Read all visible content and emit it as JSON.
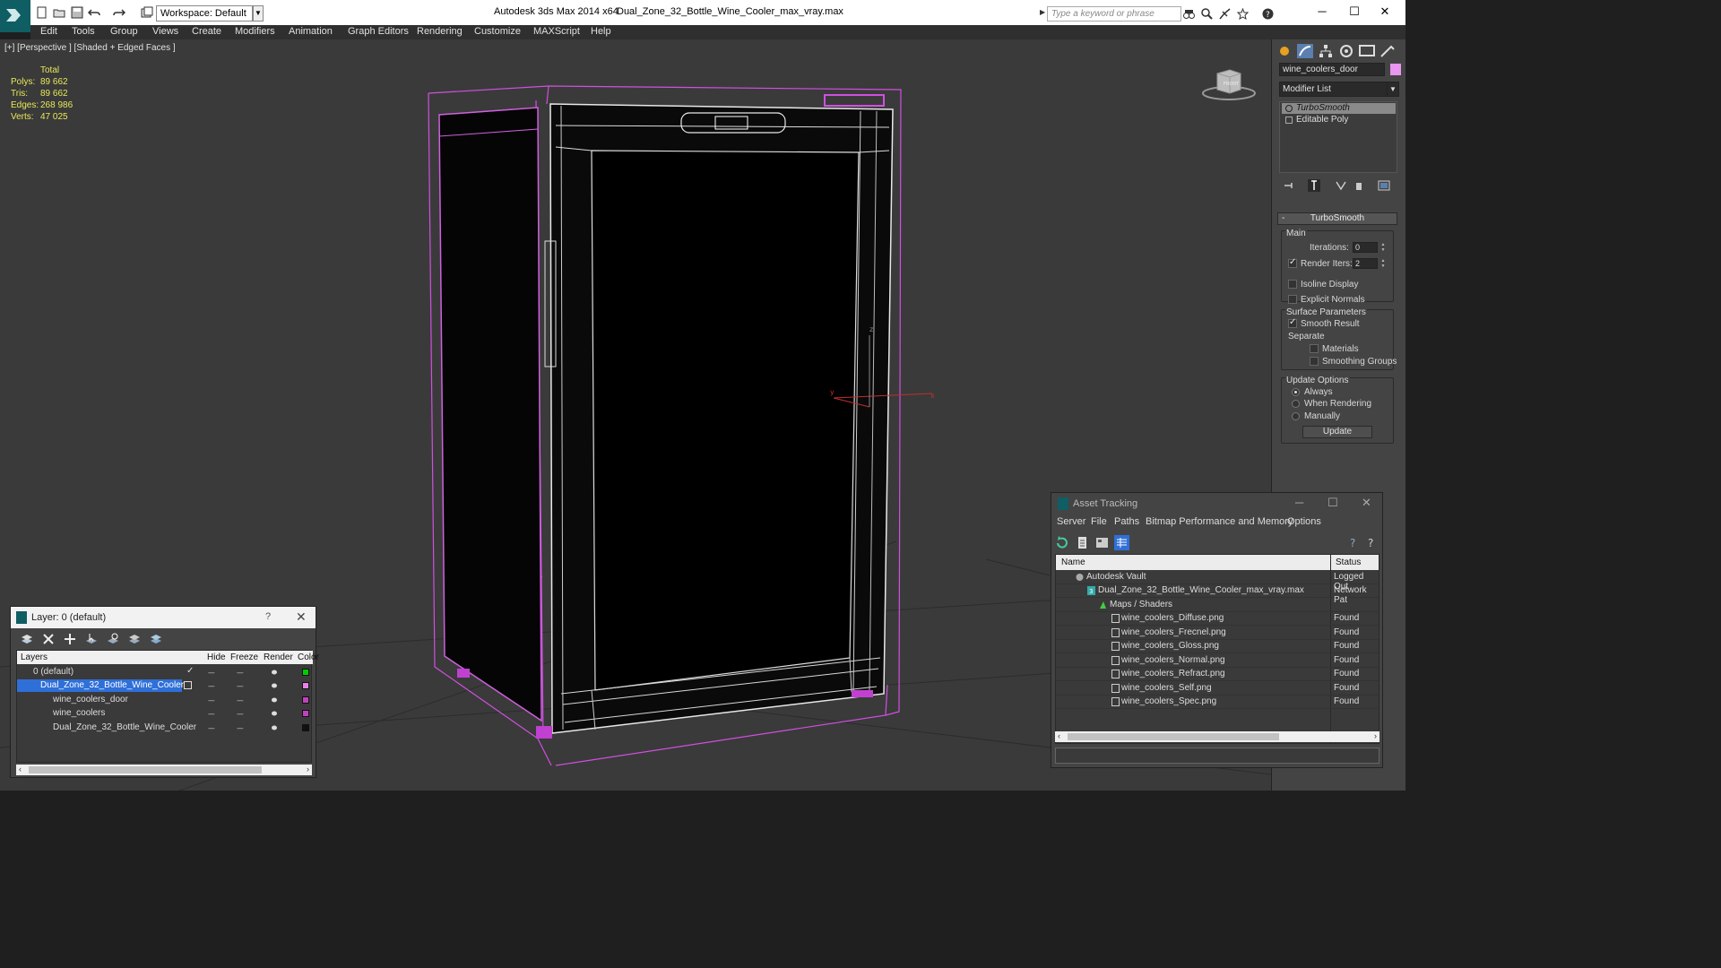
{
  "titlebar": {
    "workspace": "Workspace: Default",
    "app_title": "Autodesk 3ds Max  2014 x64",
    "file_title": "Dual_Zone_32_Bottle_Wine_Cooler_max_vray.max",
    "search_placeholder": "Type a keyword or phrase"
  },
  "menu": [
    "Edit",
    "Tools",
    "Group",
    "Views",
    "Create",
    "Modifiers",
    "Animation",
    "Graph Editors",
    "Rendering",
    "Customize",
    "MAXScript",
    "Help"
  ],
  "viewport": {
    "label": "[+] [Perspective ] [Shaded + Edged Faces ]",
    "stats_header": "Total",
    "stats": [
      {
        "key": "Polys:",
        "value": "89 662"
      },
      {
        "key": "Tris:",
        "value": "89 662"
      },
      {
        "key": "Edges:",
        "value": "268 986"
      },
      {
        "key": "Verts:",
        "value": "47 025"
      }
    ],
    "viewcube_label": "FRONT"
  },
  "command_panel": {
    "object_name": "wine_coolers_door",
    "object_color": "#e896f0",
    "modifier_list": "Modifier List",
    "stack": [
      "TurboSmooth",
      "Editable Poly"
    ],
    "rollout_title": "TurboSmooth",
    "main_group": "Main",
    "iterations_label": "Iterations:",
    "iterations_value": "0",
    "render_iters_label": "Render Iters:",
    "render_iters_value": "2",
    "isoline_label": "Isoline Display",
    "explicit_label": "Explicit Normals",
    "surface_group": "Surface Parameters",
    "smooth_label": "Smooth Result",
    "separate_label": "Separate",
    "materials_label": "Materials",
    "smoothing_label": "Smoothing Groups",
    "update_group": "Update Options",
    "always_label": "Always",
    "when_rendering_label": "When Rendering",
    "manually_label": "Manually",
    "update_button": "Update"
  },
  "layer_window": {
    "title": "Layer: 0 (default)",
    "help": "?",
    "columns": [
      "Layers",
      "Hide",
      "Freeze",
      "Render",
      "Color"
    ],
    "rows": [
      {
        "name": "0 (default)",
        "color": "#00cc00",
        "selected": false
      },
      {
        "name": "Dual_Zone_32_Bottle_Wine_Cooler",
        "color": "#e880e8",
        "selected": true
      },
      {
        "name": "wine_coolers_door",
        "color": "#c040c0",
        "selected": false
      },
      {
        "name": "wine_coolers",
        "color": "#c040c0",
        "selected": false
      },
      {
        "name": "Dual_Zone_32_Bottle_Wine_Cooler",
        "color": "#111111",
        "selected": false
      }
    ]
  },
  "asset_window": {
    "title": "Asset Tracking",
    "menu": [
      "Server",
      "File",
      "Paths",
      "Bitmap Performance and Memory",
      "Options"
    ],
    "columns": [
      "Name",
      "Status"
    ],
    "rows": [
      {
        "name": "Autodesk Vault",
        "status": "Logged Out"
      },
      {
        "name": "Dual_Zone_32_Bottle_Wine_Cooler_max_vray.max",
        "status": "Network Pat"
      },
      {
        "name": "Maps / Shaders",
        "status": ""
      },
      {
        "name": "wine_coolers_Diffuse.png",
        "status": "Found"
      },
      {
        "name": "wine_coolers_Frecnel.png",
        "status": "Found"
      },
      {
        "name": "wine_coolers_Gloss.png",
        "status": "Found"
      },
      {
        "name": "wine_coolers_Normal.png",
        "status": "Found"
      },
      {
        "name": "wine_coolers_Refract.png",
        "status": "Found"
      },
      {
        "name": "wine_coolers_Self.png",
        "status": "Found"
      },
      {
        "name": "wine_coolers_Spec.png",
        "status": "Found"
      }
    ]
  }
}
